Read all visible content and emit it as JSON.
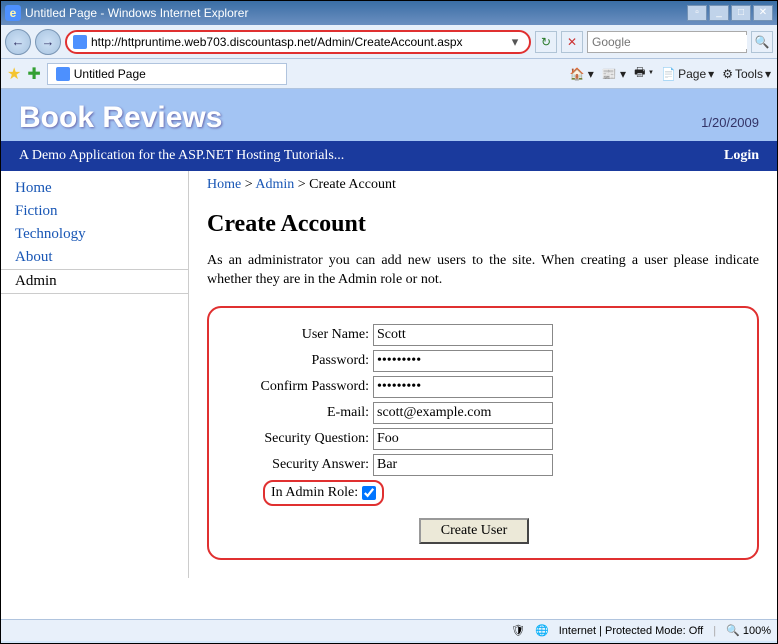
{
  "window": {
    "title": "Untitled Page - Windows Internet Explorer"
  },
  "nav": {
    "url": "http://httpruntime.web703.discountasp.net/Admin/CreateAccount.aspx",
    "search_placeholder": "Google"
  },
  "tab": {
    "label": "Untitled Page"
  },
  "toolbar": {
    "page": "Page",
    "tools": "Tools"
  },
  "site": {
    "title": "Book Reviews",
    "date": "1/20/2009",
    "tagline": "A Demo Application for the ASP.NET Hosting Tutorials...",
    "login": "Login"
  },
  "sidebar": {
    "items": [
      "Home",
      "Fiction",
      "Technology",
      "About",
      "Admin"
    ]
  },
  "breadcrumb": {
    "home": "Home",
    "admin": "Admin",
    "sep": ">",
    "current": "Create Account"
  },
  "page": {
    "heading": "Create Account",
    "intro": "As an administrator you can add new users to the site. When creating a user please indicate whether they are in the Admin role or not."
  },
  "form": {
    "username_label": "User Name:",
    "username_value": "Scott",
    "password_label": "Password:",
    "password_value": "password1",
    "confirm_label": "Confirm Password:",
    "confirm_value": "password1",
    "email_label": "E-mail:",
    "email_value": "scott@example.com",
    "question_label": "Security Question:",
    "question_value": "Foo",
    "answer_label": "Security Answer:",
    "answer_value": "Bar",
    "admin_label": "In Admin Role:",
    "submit": "Create User"
  },
  "status": {
    "mode": "Internet | Protected Mode: Off",
    "zoom": "100%"
  }
}
